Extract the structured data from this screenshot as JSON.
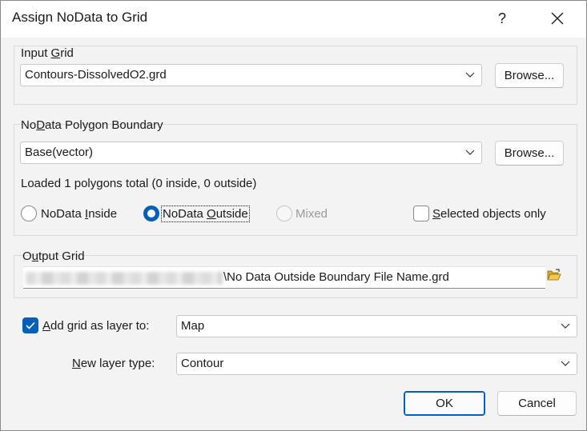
{
  "window": {
    "title": "Assign NoData to Grid",
    "help_label": "?"
  },
  "input_grid": {
    "label_pre": "Input ",
    "label_accel": "G",
    "label_post": "rid",
    "value": "Contours-DissolvedO2.grd",
    "browse_label": "Browse..."
  },
  "boundary": {
    "label_pre": "No",
    "label_accel": "D",
    "label_post": "ata Polygon Boundary",
    "value": "Base(vector)",
    "browse_label": "Browse...",
    "status": "Loaded 1 polygons total (0 inside, 0 outside)",
    "radio_inside": {
      "pre": "NoData ",
      "accel": "I",
      "post": "nside",
      "selected": false
    },
    "radio_outside": {
      "pre": "NoData ",
      "accel": "O",
      "post": "utside",
      "selected": true
    },
    "radio_mixed": {
      "label": "Mixed",
      "enabled": false
    },
    "selected_only": {
      "accel": "S",
      "post": "elected objects only",
      "checked": false
    }
  },
  "output_grid": {
    "label_pre": "O",
    "label_accel": "u",
    "label_post": "tput Grid",
    "path_suffix": "\\No Data Outside Boundary File Name.grd"
  },
  "add_layer": {
    "checked": true,
    "label_accel": "A",
    "label_post": "dd grid as layer to:",
    "value": "Map"
  },
  "layer_type": {
    "label_accel": "N",
    "label_post": "ew layer type:",
    "value": "Contour"
  },
  "footer": {
    "ok_label": "OK",
    "cancel_label": "Cancel"
  },
  "colors": {
    "accent": "#005fb8",
    "dialog_bg": "#f3f3f3",
    "title_bg": "#ffffff"
  }
}
